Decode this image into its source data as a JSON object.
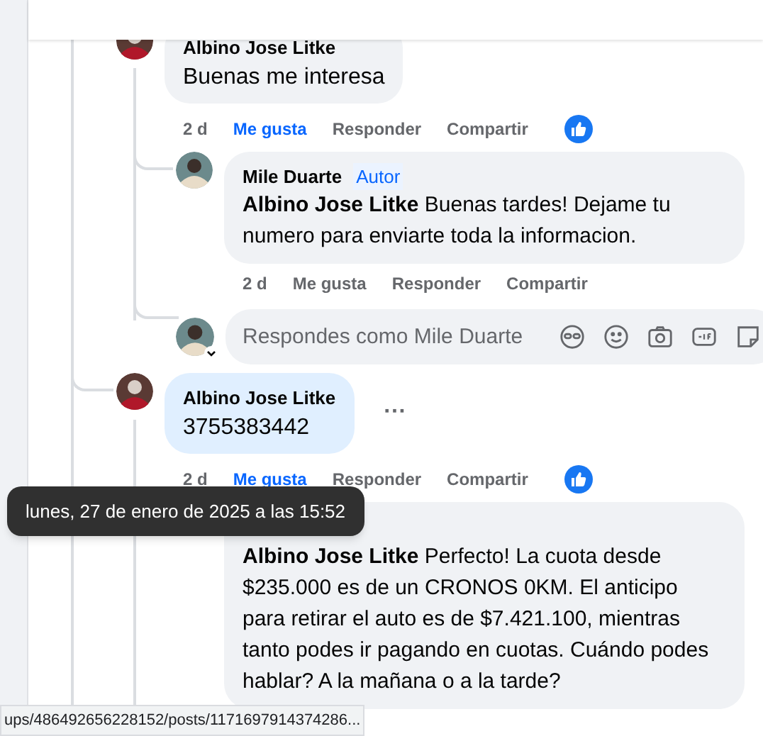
{
  "comments": [
    {
      "author": "Albino Jose Litke",
      "text": "Buenas me interesa",
      "highlighted": false,
      "time": "2 d",
      "time_hovered": false,
      "liked": true,
      "actions": [
        {
          "label": "Me gusta",
          "selected": true
        },
        {
          "label": "Responder",
          "selected": false
        },
        {
          "label": "Compartir",
          "selected": false
        }
      ],
      "replies": [
        {
          "author": "Mile Duarte",
          "badge": "Autor",
          "mention": "Albino Jose Litke",
          "text": "Buenas tardes! Dejame tu numero para enviarte toda la informacion.",
          "time": "2 d",
          "actions": [
            {
              "label": "Me gusta",
              "selected": false
            },
            {
              "label": "Responder",
              "selected": false
            },
            {
              "label": "Compartir",
              "selected": false
            }
          ]
        }
      ],
      "reply_box": {
        "placeholder": "Respondes como Mile Duarte"
      }
    },
    {
      "author": "Albino Jose Litke",
      "text": "3755383442",
      "highlighted": true,
      "more": "···",
      "time": "2 d",
      "time_hovered": true,
      "liked": true,
      "actions": [
        {
          "label": "Me gusta",
          "selected": true
        },
        {
          "label": "Responder",
          "selected": false
        },
        {
          "label": "Compartir",
          "selected": false
        }
      ],
      "replies": [
        {
          "mention": "Albino Jose Litke",
          "text": "Perfecto! La cuota desde $235.000 es de un CRONOS 0KM. El anticipo para retirar el auto es de $7.421.100, mientras tanto podes ir pagando en cuotas. Cuándo podes hablar? A la mañana o a la tarde?"
        }
      ]
    }
  ],
  "tooltip": "lunes, 27 de enero de 2025 a las 15:52",
  "status_url": "ups/486492656228152/posts/1171697914374286..."
}
